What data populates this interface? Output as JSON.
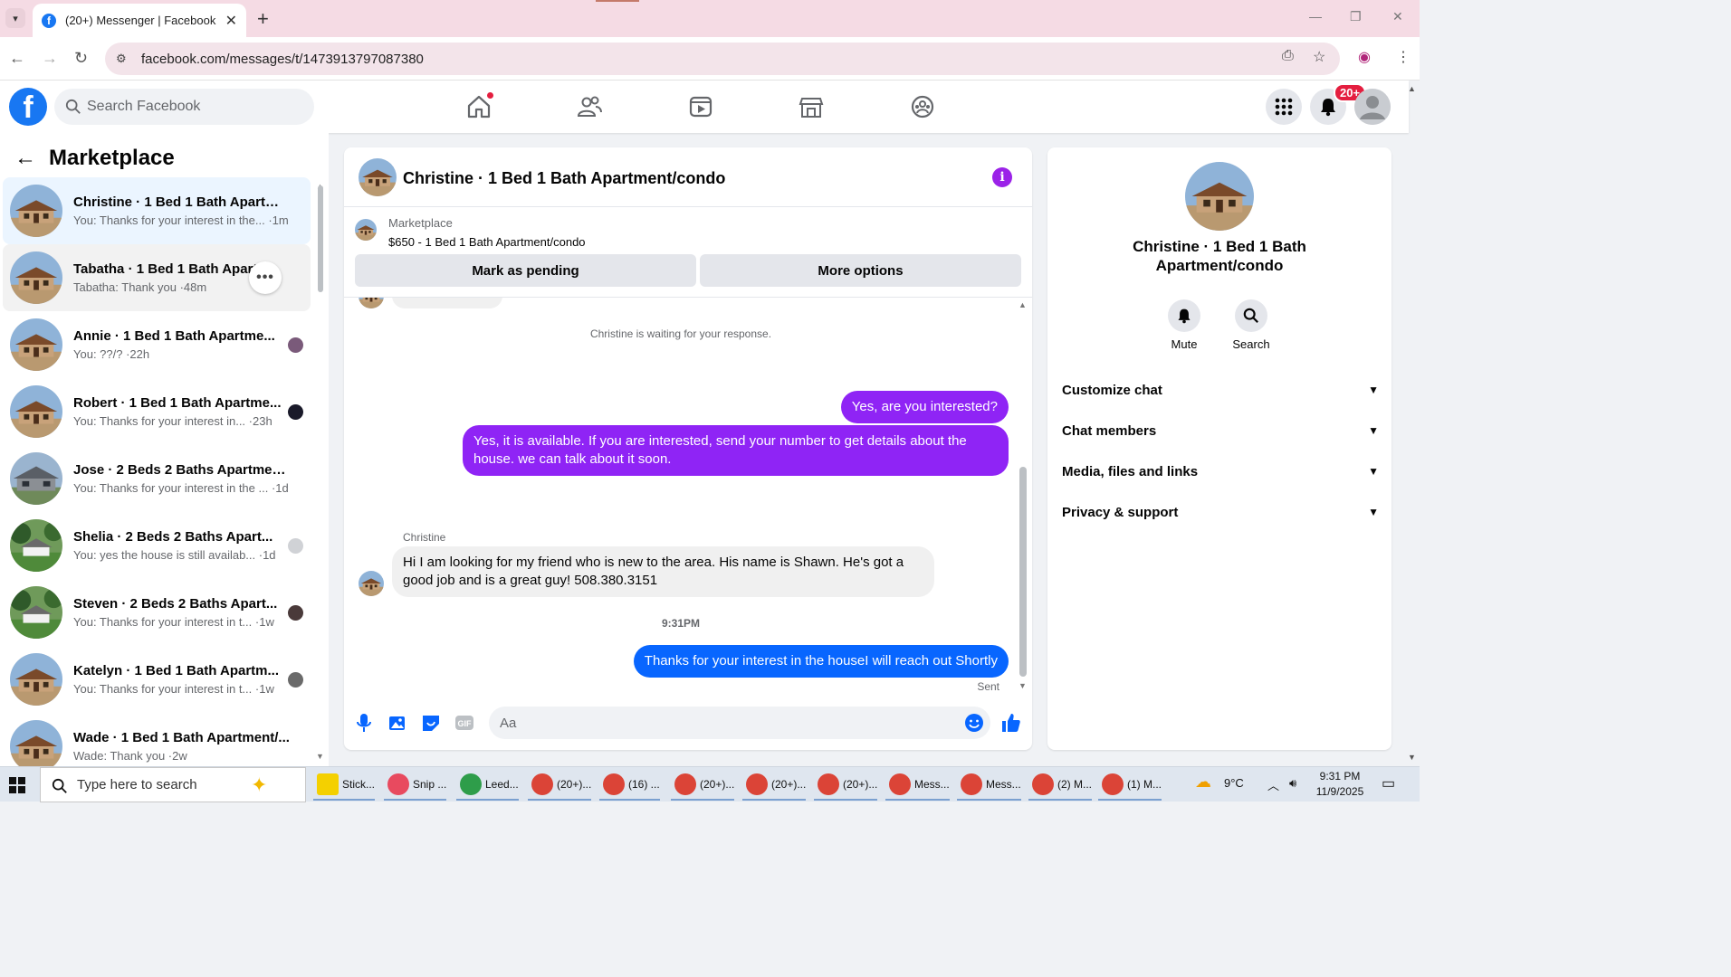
{
  "browser": {
    "tab_title": "(20+) Messenger | Facebook",
    "url": "facebook.com/messages/t/1473913797087380"
  },
  "fb_nav": {
    "search_placeholder": "Search Facebook",
    "notification_badge": "20+"
  },
  "left_panel": {
    "title": "Marketplace",
    "conversations": [
      {
        "name": "Christine · 1 Bed 1 Bath Apartme...",
        "last": "You: Thanks for your interest in the... ·1m"
      },
      {
        "name": "Tabatha · 1 Bed 1 Bath Apartm...",
        "last": "Tabatha: Thank you ·48m"
      },
      {
        "name": "Annie · 1 Bed 1 Bath Apartme...",
        "last": "You: ??/? ·22h"
      },
      {
        "name": "Robert · 1 Bed 1 Bath Apartme...",
        "last": "You: Thanks for your interest in... ·23h"
      },
      {
        "name": "Jose · 2 Beds 2 Baths Apartment...",
        "last": "You: Thanks for your interest in the ... ·1d"
      },
      {
        "name": "Shelia · 2 Beds 2 Baths Apart...",
        "last": "You: yes the house is still availab... ·1d"
      },
      {
        "name": "Steven · 2 Beds 2 Baths Apart...",
        "last": "You: Thanks for your interest in t... ·1w"
      },
      {
        "name": "Katelyn · 1 Bed 1 Bath Apartm...",
        "last": "You: Thanks for your interest in t... ·1w"
      },
      {
        "name": "Wade · 1 Bed 1 Bath Apartment/...",
        "last": "Wade: Thank you ·2w"
      }
    ]
  },
  "chat": {
    "title": "Christine · 1 Bed 1 Bath Apartment/condo",
    "marketplace_label": "Marketplace",
    "listing": "$650 - 1 Bed 1 Bath Apartment/condo",
    "btn_pending": "Mark as pending",
    "btn_more": "More options",
    "waiting": "Christine is waiting for your response.",
    "msg_out_1": "Yes, are you interested?",
    "msg_out_2": "Yes, it is available. If you are interested, send your number to get details about the house. we can talk about it soon.",
    "sender": "Christine",
    "msg_in_1": "Hi I am looking for my friend who is new to the area.  His name is Shawn. He's got a good job and is a great guy! 508.380.3151",
    "time": "9:31PM",
    "msg_out_3": "Thanks for your interest in the houseI will reach out Shortly",
    "sent_label": "Sent",
    "composer_placeholder": "Aa"
  },
  "right_panel": {
    "name": "Christine · 1 Bed 1 Bath Apartment/condo",
    "mute": "Mute",
    "search": "Search",
    "rows": [
      "Customize chat",
      "Chat members",
      "Media, files and links",
      "Privacy & support"
    ]
  },
  "taskbar": {
    "search_placeholder": "Type here to search",
    "items": [
      "Stick...",
      "Snip ...",
      "Leed...",
      "(20+)...",
      "(16) ...",
      "(20+)...",
      "(20+)...",
      "(20+)...",
      "Mess...",
      "Mess...",
      "(2) M...",
      "(1) M..."
    ],
    "weather": "9°C",
    "time": "9:31 PM",
    "date": "11/9/2025"
  },
  "colors": {
    "fb_blue": "#1877f2",
    "bubble_purple": "#8f24f5",
    "bubble_blue": "#0866ff"
  }
}
